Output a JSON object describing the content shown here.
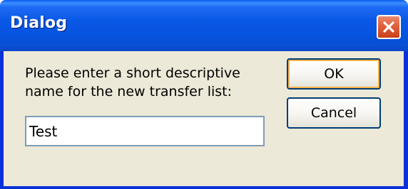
{
  "window": {
    "title": "Dialog",
    "close_icon": "close-x-icon"
  },
  "dialog": {
    "prompt": "Please enter a short descriptive\nname for the new transfer list:",
    "input_value": "Test",
    "ok_label": "OK",
    "cancel_label": "Cancel"
  },
  "colors": {
    "titlebar": "#0a58e6",
    "client_bg": "#ece9d8",
    "close_button": "#e2643f",
    "input_border": "#7f9db9",
    "button_border": "#003c74"
  }
}
